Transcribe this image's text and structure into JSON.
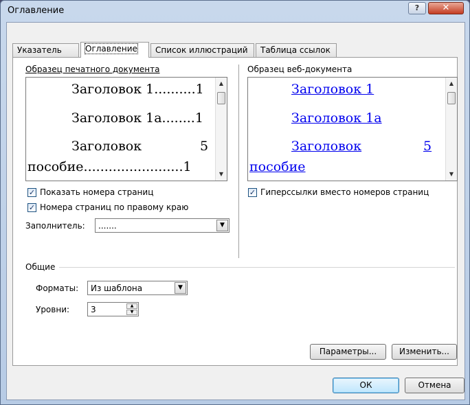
{
  "window": {
    "title": "Оглавление",
    "help_glyph": "?",
    "close_glyph": "✕"
  },
  "tabs": [
    "Указатель",
    "Оглавление",
    "Список иллюстраций",
    "Таблица ссылок"
  ],
  "print_preview": {
    "label": "Образец печатного документа",
    "lines": [
      {
        "text": "Заголовок 1..........1"
      },
      {
        "text": "Заголовок 1а........1"
      },
      {
        "text": "Заголовок",
        "page": "5"
      },
      {
        "text": "пособие........................1"
      }
    ]
  },
  "web_preview": {
    "label": "Образец веб-документа",
    "lines": [
      "Заголовок 1",
      "Заголовок 1а",
      "Заголовок",
      "5",
      "пособие"
    ]
  },
  "options": {
    "show_page_numbers": {
      "label": "Показать номера страниц",
      "checked": true
    },
    "right_align": {
      "label": "Номера страниц по правому краю",
      "checked": true
    },
    "hyperlinks": {
      "label": "Гиперссылки вместо номеров страниц",
      "checked": true
    },
    "leader_label": "Заполнитель:",
    "leader_value": "......."
  },
  "general": {
    "label": "Общие",
    "formats_label": "Форматы:",
    "formats_value": "Из шаблона",
    "levels_label": "Уровни:",
    "levels_value": "3"
  },
  "buttons": {
    "parameters": "Параметры...",
    "modify": "Изменить...",
    "ok": "ОК",
    "cancel": "Отмена"
  }
}
